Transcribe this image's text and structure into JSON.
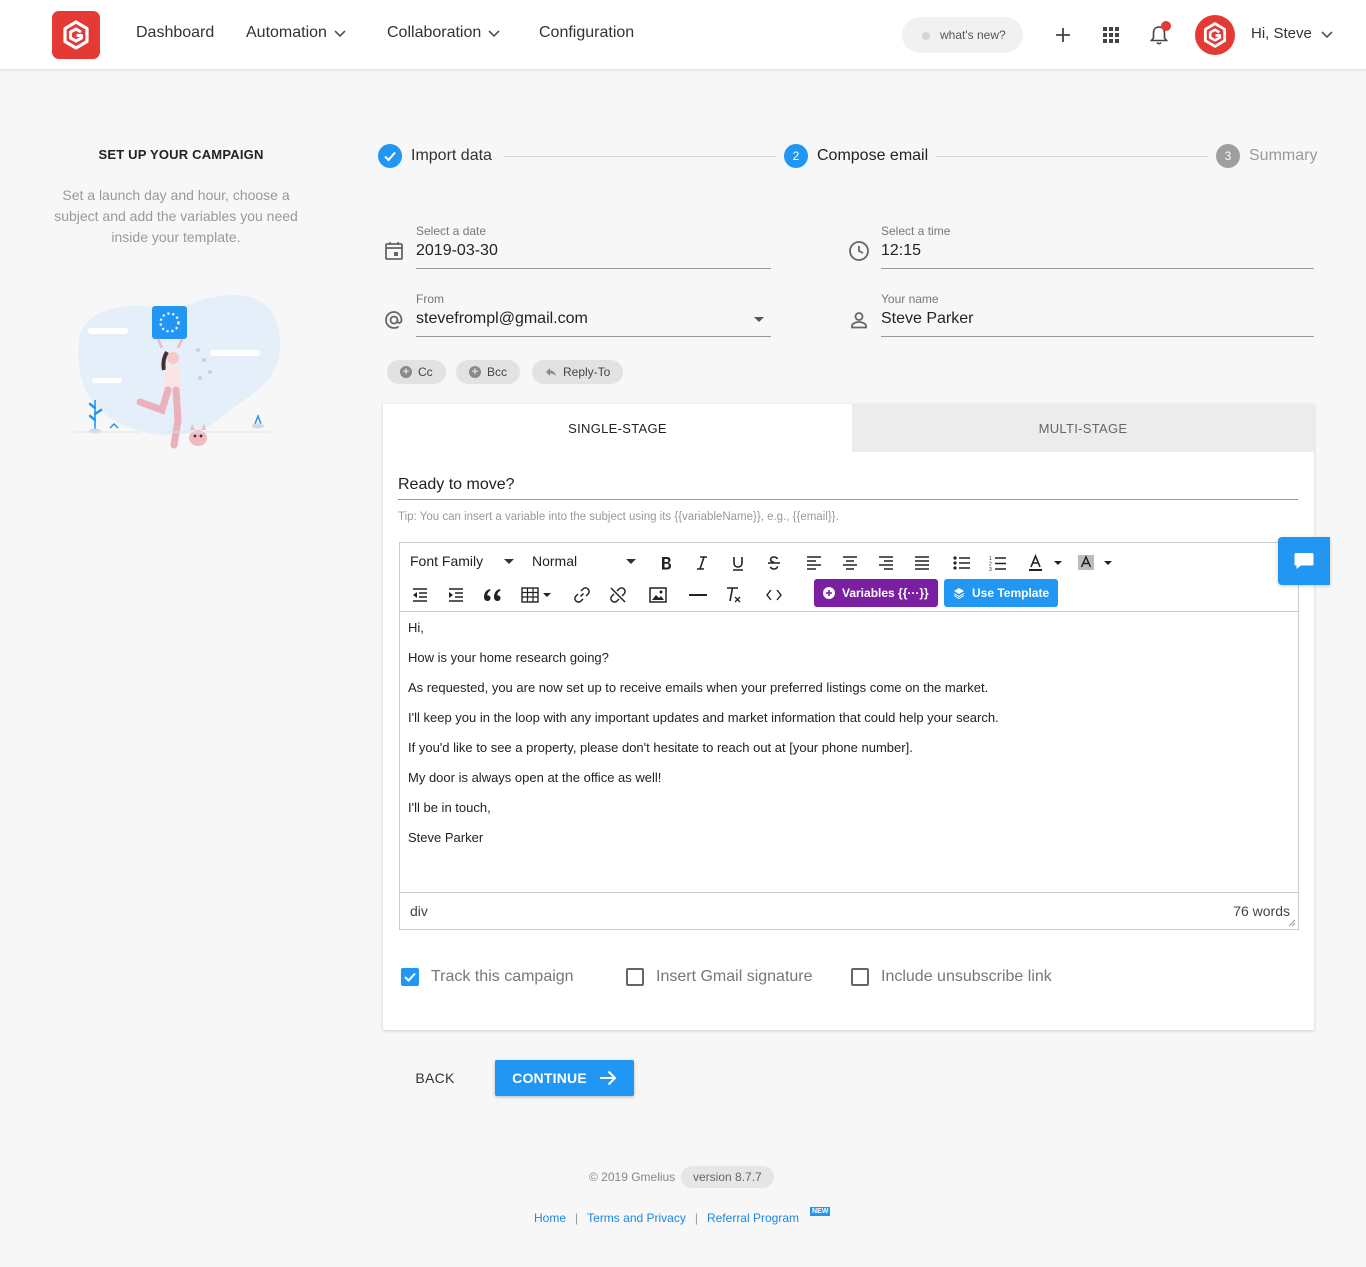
{
  "header": {
    "nav": [
      "Dashboard",
      "Automation",
      "Collaboration",
      "Configuration"
    ],
    "whats_new": "what's new?",
    "greeting": "Hi, Steve",
    "notification_color": "#e53935",
    "brand_color": "#e53935"
  },
  "left_panel": {
    "title": "SET UP YOUR CAMPAIGN",
    "description": "Set a launch day and hour, choose a subject and add the variables you need inside your template."
  },
  "stepper": {
    "steps": [
      {
        "label": "Import data",
        "state": "done",
        "number": ""
      },
      {
        "label": "Compose email",
        "state": "active",
        "number": "2"
      },
      {
        "label": "Summary",
        "state": "pending",
        "number": "3"
      }
    ]
  },
  "form": {
    "date": {
      "label": "Select a date",
      "value": "2019-03-30"
    },
    "time": {
      "label": "Select a time",
      "value": "12:15"
    },
    "from": {
      "label": "From",
      "value": "stevefrompl@gmail.com"
    },
    "name": {
      "label": "Your name",
      "value": "Steve Parker"
    },
    "chips": [
      "Cc",
      "Bcc",
      "Reply-To"
    ]
  },
  "tabs": {
    "single": "SINGLE-STAGE",
    "multi": "MULTI-STAGE",
    "active": "single"
  },
  "subject": "Ready to move?",
  "tip": "Tip: You can insert a variable into the subject using its {{variableName}}, e.g., {{email}}.",
  "toolbar": {
    "font_family": "Font Family",
    "paragraph": "Normal",
    "variables_btn": "Variables {{···}}",
    "template_btn": "Use Template",
    "variables_color": "#7b1fa2",
    "template_color": "#2196f3"
  },
  "body": {
    "lines": [
      "Hi,",
      "How is your home research going?",
      "As requested, you are now set up to receive emails when your preferred listings come on the market.",
      "I'll keep you in the loop with any important updates and market information that could help your search.",
      "If you'd like to see a property, please don't hesitate to reach out at [your phone number].",
      "My door is always open at the office as well!",
      "I'll be in touch,",
      "Steve Parker"
    ],
    "path": "div",
    "word_count": "76 words"
  },
  "options": {
    "track": {
      "label": "Track this campaign",
      "checked": true
    },
    "signature": {
      "label": "Insert Gmail signature",
      "checked": false
    },
    "unsubscribe": {
      "label": "Include unsubscribe link",
      "checked": false
    }
  },
  "actions": {
    "back": "BACK",
    "continue": "CONTINUE"
  },
  "footer": {
    "copyright": "© 2019 Gmelius",
    "version": "version 8.7.7",
    "links": [
      "Home",
      "Terms and Privacy",
      "Referral Program"
    ],
    "new_badge": "NEW"
  }
}
